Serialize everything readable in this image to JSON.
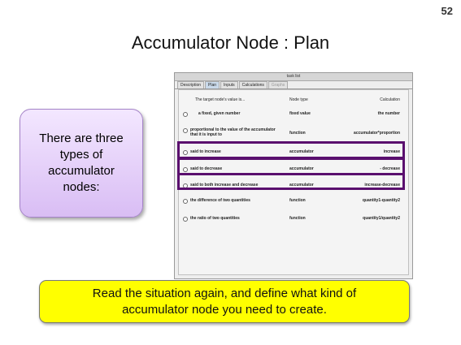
{
  "slide": {
    "number": "52",
    "title": "Accumulator Node : Plan",
    "callout": "There are three types of accumulator nodes:",
    "note": "Read the situation again, and define what kind of accumulator node you need to create."
  },
  "window": {
    "title": "task list",
    "tabs": [
      "Description",
      "Plan",
      "Inputs",
      "Calculations",
      "Graphs"
    ],
    "active_tab": "Plan",
    "disabled_tab": "Graphs",
    "headers": {
      "target": "The target node's value is...",
      "type": "Node type",
      "calc": "Calculation"
    },
    "rows": [
      {
        "target": "a fixed, given number",
        "type": "fixed value",
        "calc": "the number"
      },
      {
        "target": "proportional to the value of the accumulator that it is input to",
        "type": "function",
        "calc": "accumulator*proportion"
      },
      {
        "target": "said to increase",
        "type": "accumulator",
        "calc": "increase"
      },
      {
        "target": "said to decrease",
        "type": "accumulator",
        "calc": "- decrease"
      },
      {
        "target": "said to both increase and decrease",
        "type": "accumulator",
        "calc": "increase-decrease"
      },
      {
        "target": "the difference of two quantities",
        "type": "function",
        "calc": "quantity1-quantity2"
      },
      {
        "target": "the ratio of two quantities",
        "type": "function",
        "calc": "quantity1/quantity2"
      }
    ]
  },
  "colors": {
    "highlight": "#5a0f6e",
    "note_background": "#ffff00",
    "callout_background": "#d9bdf4"
  }
}
